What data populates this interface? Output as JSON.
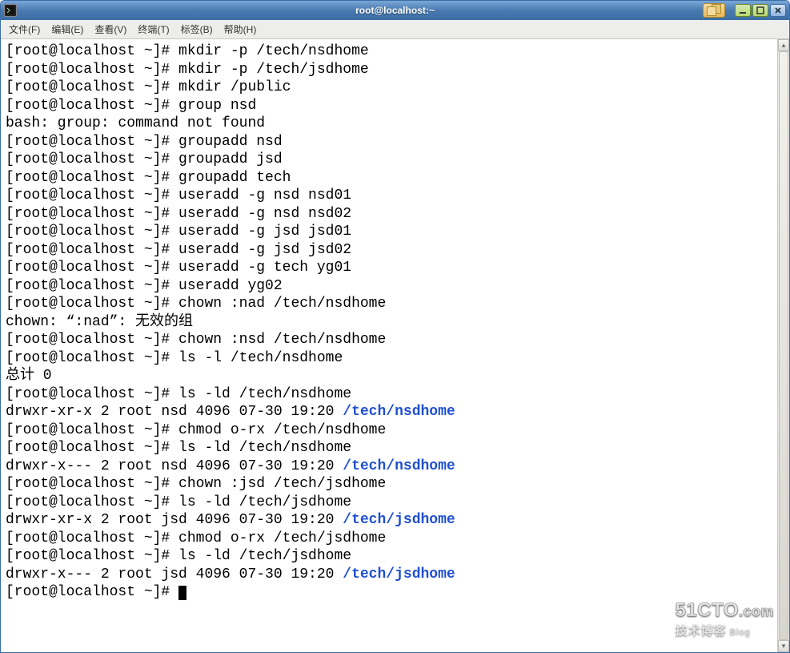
{
  "window": {
    "title": "root@localhost:~"
  },
  "menu": {
    "file": "文件(F)",
    "edit": "编辑(E)",
    "view": "查看(V)",
    "terminal": "终端(T)",
    "tabs": "标签(B)",
    "help": "帮助(H)"
  },
  "prompt": "[root@localhost ~]# ",
  "lines": [
    {
      "t": "cmd",
      "text": "mkdir -p /tech/nsdhome"
    },
    {
      "t": "cmd",
      "text": "mkdir -p /tech/jsdhome"
    },
    {
      "t": "cmd",
      "text": "mkdir /public"
    },
    {
      "t": "cmd",
      "text": "group nsd"
    },
    {
      "t": "out",
      "text": "bash: group: command not found"
    },
    {
      "t": "cmd",
      "text": "groupadd nsd"
    },
    {
      "t": "cmd",
      "text": "groupadd jsd"
    },
    {
      "t": "cmd",
      "text": "groupadd tech"
    },
    {
      "t": "cmd",
      "text": "useradd -g nsd nsd01"
    },
    {
      "t": "cmd",
      "text": "useradd -g nsd nsd02"
    },
    {
      "t": "cmd",
      "text": "useradd -g jsd jsd01"
    },
    {
      "t": "cmd",
      "text": "useradd -g jsd jsd02"
    },
    {
      "t": "cmd",
      "text": "useradd -g tech yg01"
    },
    {
      "t": "cmd",
      "text": "useradd yg02"
    },
    {
      "t": "cmd",
      "text": "chown :nad /tech/nsdhome"
    },
    {
      "t": "out",
      "text": "chown: “:nad”: 无效的组"
    },
    {
      "t": "cmd",
      "text": "chown :nsd /tech/nsdhome"
    },
    {
      "t": "cmd",
      "text": "ls -l /tech/nsdhome"
    },
    {
      "t": "out",
      "text": "总计 0"
    },
    {
      "t": "cmd",
      "text": "ls -ld /tech/nsdhome"
    },
    {
      "t": "ls",
      "text": "drwxr-xr-x 2 root nsd 4096 07-30 19:20 ",
      "dir": "/tech/nsdhome"
    },
    {
      "t": "cmd",
      "text": "chmod o-rx /tech/nsdhome"
    },
    {
      "t": "cmd",
      "text": "ls -ld /tech/nsdhome"
    },
    {
      "t": "ls",
      "text": "drwxr-x--- 2 root nsd 4096 07-30 19:20 ",
      "dir": "/tech/nsdhome"
    },
    {
      "t": "cmd",
      "text": "chown :jsd /tech/jsdhome"
    },
    {
      "t": "cmd",
      "text": "ls -ld /tech/jsdhome"
    },
    {
      "t": "ls",
      "text": "drwxr-xr-x 2 root jsd 4096 07-30 19:20 ",
      "dir": "/tech/jsdhome"
    },
    {
      "t": "cmd",
      "text": "chmod o-rx /tech/jsdhome"
    },
    {
      "t": "cmd",
      "text": "ls -ld /tech/jsdhome"
    },
    {
      "t": "ls",
      "text": "drwxr-x--- 2 root jsd 4096 07-30 19:20 ",
      "dir": "/tech/jsdhome"
    },
    {
      "t": "cursor"
    }
  ],
  "watermark": {
    "line1a": "51CTO",
    "line1b": ".com",
    "line2a": "技术博客",
    "line2b": "Blog"
  }
}
